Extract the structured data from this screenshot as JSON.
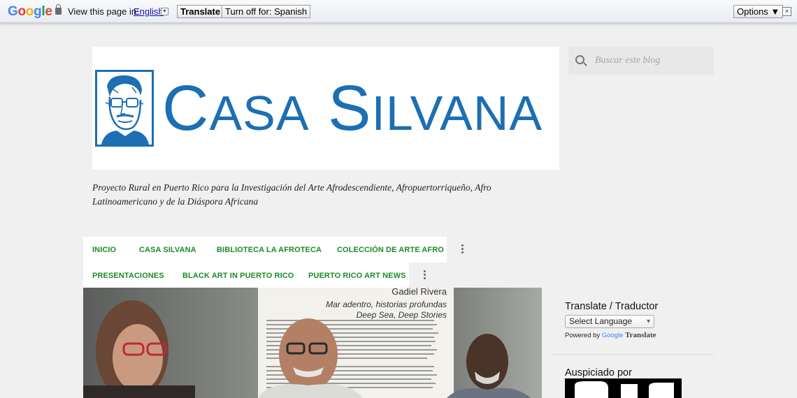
{
  "translate_bar": {
    "logo": "Google",
    "view_label": "View this page in:",
    "language": "English",
    "translate_button": "Translate",
    "turn_off_button": "Turn off for: Spanish",
    "options_button": "Options ▼",
    "close_glyph": "×"
  },
  "header": {
    "logo_text_1": "C",
    "logo_text_2": "ASA",
    "logo_text_3": "S",
    "logo_text_4": "ILVANA",
    "tagline": "Proyecto Rural en Puerto Rico para la Investigación del Arte Afrodescendiente, Afropuertorriqueño, Afro Latinoamericano y de la Diáspora Africana",
    "brand_color": "#1c6fb3"
  },
  "nav": {
    "row1": [
      "INICIO",
      "CASA SILVANA",
      "BIBLIOTECA LA AFROTECA",
      "COLECCIÓN DE ARTE AFRO"
    ],
    "row2": [
      "PRESENTACIONES",
      "BLACK ART IN PUERTO RICO",
      "PUERTO RICO ART NEWS"
    ],
    "link_color": "#1a8a2a"
  },
  "post_image": {
    "poster_name": "Gadiel Rivera",
    "poster_title_1": "Mar adentro, historias profundas",
    "poster_title_2": "Deep Sea, Deep Stories"
  },
  "sidebar": {
    "search_placeholder": "Buscar este blog",
    "translate_title": "Translate / Traductor",
    "select_language": "Select Language",
    "powered_by": "Powered by",
    "powered_google": "Google",
    "powered_translate": "Translate",
    "sponsor_title": "Auspiciado por"
  }
}
